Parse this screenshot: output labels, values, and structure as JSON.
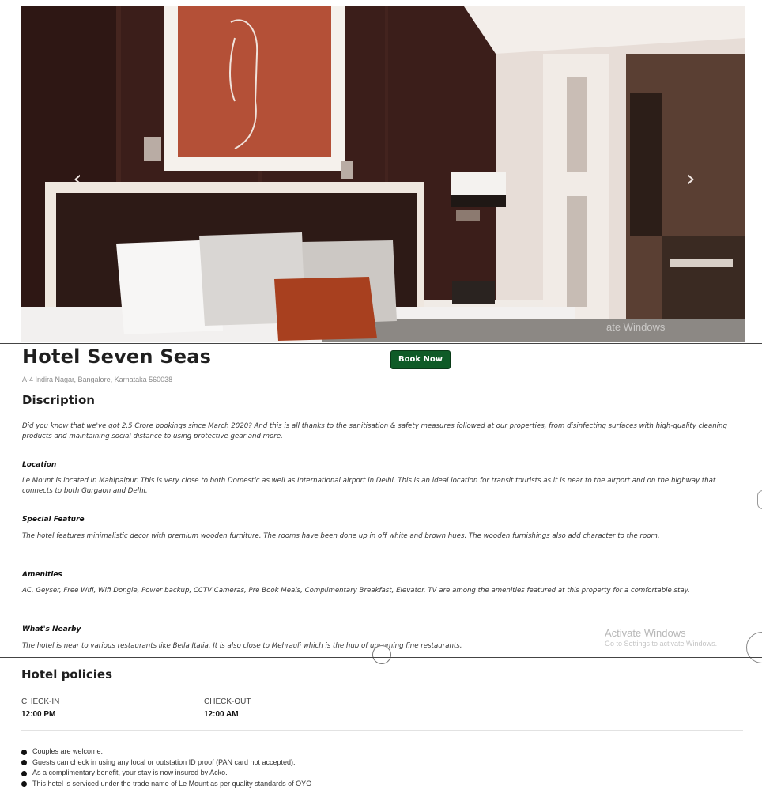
{
  "hotel": {
    "name": "Hotel Seven Seas",
    "book_label": "Book Now",
    "address": "A-4 Indira Nagar, Bangalore, Karnataka 560038"
  },
  "carousel": {
    "prev_glyph": "‹",
    "next_glyph": "›",
    "overlay_text": "ate Windows"
  },
  "description": {
    "title": "Discription",
    "text": "Did you know that we've got 2.5 Crore bookings since March 2020? And this is all thanks to the sanitisation & safety measures followed at our properties, from disinfecting surfaces with high-quality cleaning products and maintaining social distance to using protective gear and more.",
    "sections": [
      {
        "heading": "Location",
        "text": "Le Mount is located in Mahipalpur. This is very close to both Domestic as well as International airport in Delhi. This is an ideal location for transit tourists as it is near to the airport and on the highway that connects to both Gurgaon and Delhi."
      },
      {
        "heading": "Special Feature",
        "text": "The hotel features minimalistic decor with premium wooden furniture. The rooms have been done up in off white and brown hues. The wooden furnishings also add character to the room."
      },
      {
        "heading": "Amenities",
        "text": "AC, Geyser, Free Wifi, Wifi Dongle, Power backup, CCTV Cameras, Pre Book Meals, Complimentary Breakfast, Elevator, TV are among the amenities featured at this property for a comfortable stay."
      },
      {
        "heading": "What's Nearby",
        "text": "The hotel is near to various restaurants like Bella Italia. It is also close to Mehrauli which is the hub of upcoming fine restaurants."
      }
    ]
  },
  "windows_watermark": {
    "title": "Activate Windows",
    "subtitle": "Go to Settings to activate Windows."
  },
  "policies": {
    "title": "Hotel policies",
    "checkin_label": "CHECK-IN",
    "checkin_time": "12:00 PM",
    "checkout_label": "CHECK-OUT",
    "checkout_time": "12:00 AM",
    "rules": [
      "Couples are welcome.",
      "Guests can check in using any local or outstation ID proof (PAN card not accepted).",
      "As a complimentary benefit, your stay is now insured by Acko.",
      "This hotel is serviced under the trade name of Le Mount as per quality standards of OYO"
    ]
  },
  "colors": {
    "book_button": "#0f5b27",
    "hero_wall": "#3a1d19"
  },
  "icons": [
    "chevron-left-icon",
    "chevron-right-icon",
    "bullet-icon"
  ]
}
